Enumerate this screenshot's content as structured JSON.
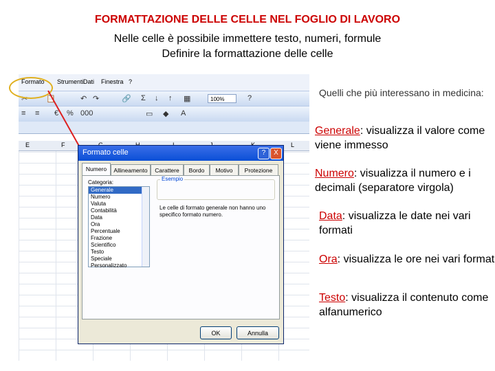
{
  "title": "FORMATTAZIONE DELLE CELLE NEL FOGLIO DI LAVORO",
  "subtitle_1": "Nelle celle è possibile immettere testo, numeri, formule",
  "subtitle_2": "Definire la formattazione delle celle",
  "toolbar": {
    "menu": [
      "Formato",
      "Strumenti",
      "Dati",
      "Finestra",
      "?"
    ],
    "zoom": "100%"
  },
  "sheet": {
    "columns": [
      "E",
      "F",
      "G",
      "H",
      "I",
      "J",
      "K",
      "L"
    ]
  },
  "dialog": {
    "title": "Formato celle",
    "help_label": "?",
    "close_label": "X",
    "tabs": [
      "Numero",
      "Allineamento",
      "Carattere",
      "Bordo",
      "Motivo",
      "Protezione"
    ],
    "category_label": "Categoria:",
    "categories": [
      "Generale",
      "Numero",
      "Valuta",
      "Contabilità",
      "Data",
      "Ora",
      "Percentuale",
      "Frazione",
      "Scientifico",
      "Testo",
      "Speciale",
      "Personalizzato"
    ],
    "selected_category": "Generale",
    "example_label": "Esempio",
    "description": "Le celle di formato generale non hanno uno specifico formato numero.",
    "ok_label": "OK",
    "cancel_label": "Annulla"
  },
  "intro": "Quelli che più interessano in medicina:",
  "bullets": [
    {
      "keyword": "Generale",
      "text": ": visualizza il valore come viene immesso"
    },
    {
      "keyword": "Numero",
      "text": ": visualizza il numero e i decimali (separatore virgola)"
    },
    {
      "keyword": "Data",
      "text": ": visualizza le date nei vari formati"
    },
    {
      "keyword": "Ora",
      "text": ": visualizza le ore nei vari formati"
    },
    {
      "keyword": "Testo",
      "text": ": visualizza il contenuto come alfanumerico"
    }
  ],
  "colors": {
    "accent_red": "#cc0000",
    "highlight_yellow": "#e0b020",
    "xp_blue": "#0b4fd6"
  }
}
